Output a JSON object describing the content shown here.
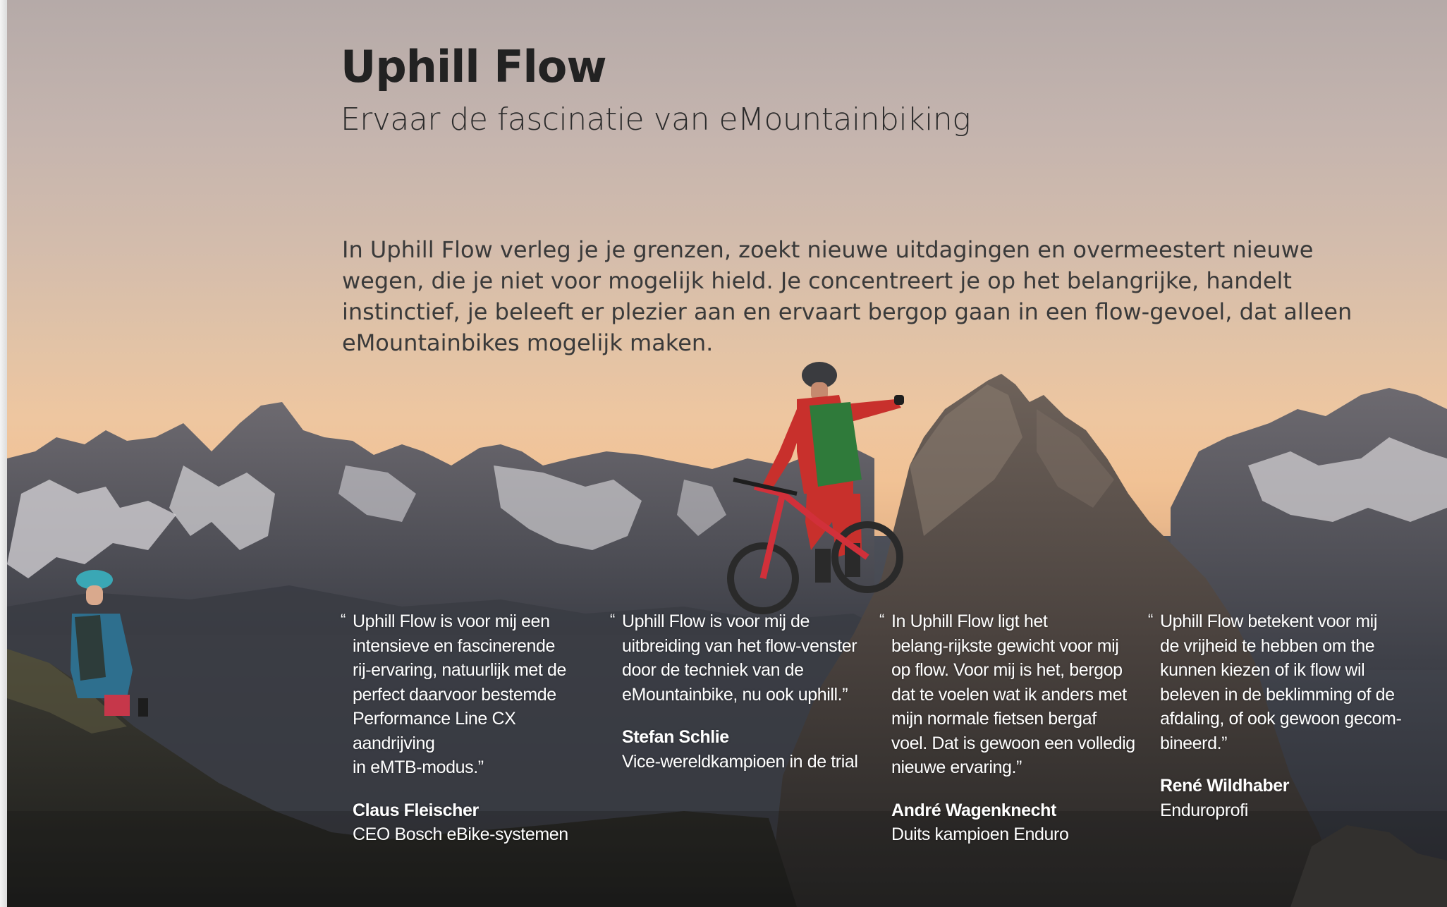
{
  "header": {
    "title": "Uphill Flow",
    "subtitle": "Ervaar de fascinatie van eMountainbiking"
  },
  "intro": "In Uphill Flow verleg je je grenzen, zoekt nieuwe uitdagingen en overmeestert nieuwe wegen, die je niet voor mogelijk hield. Je concentreert je op het belangrijke, handelt instinctief, je beleeft er plezier aan en ervaart bergop gaan in een flow-gevoel, dat alleen eMountainbikes mogelijk maken.",
  "quotes": [
    {
      "mark": "“",
      "text": "Uphill Flow is voor mij een\nintensieve en fascinerende\nrij-ervaring, natuurlijk met de\nperfect daarvoor bestemde\nPerformance Line CX aandrijving\nin eMTB-modus.”",
      "name": "Claus Fleischer",
      "role": "CEO Bosch eBike-systemen"
    },
    {
      "mark": "“",
      "text": "Uphill Flow is voor mij de\nuitbreiding van het flow-venster\ndoor de techniek van de\neMountainbike, nu ook uphill.”",
      "name": "Stefan Schlie",
      "role": "Vice-wereldkampioen in de trial"
    },
    {
      "mark": "“",
      "text": "In Uphill Flow ligt het\nbelang-rijkste gewicht voor mij\nop flow. Voor mij is het, bergop\ndat te voelen wat ik anders met\nmijn normale fietsen bergaf\nvoel. Dat is gewoon een volledig\nnieuwe ervaring.”",
      "name": "André Wagenknecht",
      "role": "Duits kampioen Enduro"
    },
    {
      "mark": "“",
      "text": "Uphill Flow betekent voor mij\nde vrijheid te hebben om the\nkunnen kiezen of ik flow wil\nbeleven in de beklimming of de\nafdaling, of ook gewoon gecom-\nbineerd.”",
      "name": "René Wildhaber",
      "role": "Enduroprofi"
    }
  ],
  "colors": {
    "title": "#222222",
    "body_text": "#3a3a3a",
    "quote_text": "#ffffff",
    "sky_top": "#b5aaa8",
    "sky_glow": "#f1c295"
  }
}
